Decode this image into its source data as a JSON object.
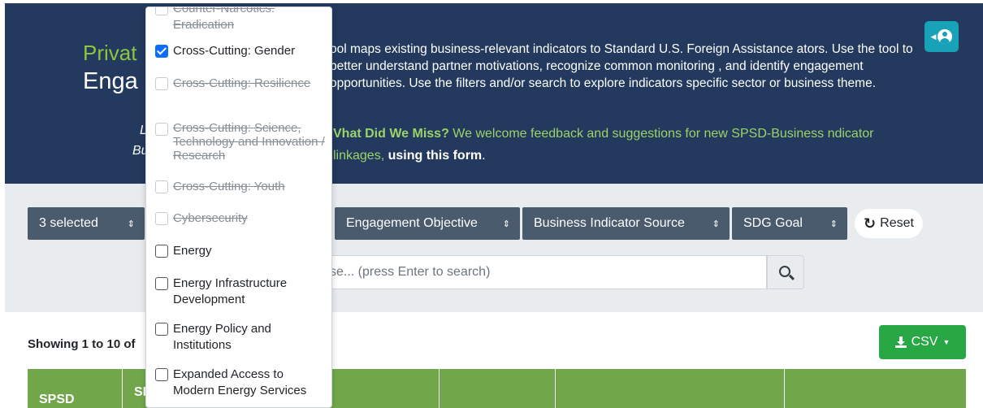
{
  "hero": {
    "title_line1": "Privat",
    "title_line2": "Enga",
    "description": "ool maps existing business-relevant indicators to Standard U.S. Foreign Assistance ators. Use the tool to better understand partner motivations, recognize common monitoring , and identify engagement opportunities. Use the filters and/or search to explore indicators specific sector or business theme.",
    "left_fragment1": "L",
    "left_fragment2": "Bu",
    "feedback_heading": "Vhat Did We Miss?",
    "feedback_text": " We welcome feedback and suggestions for new SPSD-Business ndicator linkages, ",
    "feedback_link": "using this form",
    "feedback_end": "."
  },
  "filters": {
    "sector_label": "3 selected",
    "engagement_objective": "Engagement Objective",
    "business_indicator_source": "Business Indicator Source",
    "sdg_goal": "SDG Goal",
    "sort_arrow": "⇕",
    "reset_icon": "↻",
    "reset_label": "Reset"
  },
  "search": {
    "placeholder": "se... (press Enter to search)"
  },
  "results": {
    "showing": "Showing 1 to 10 of",
    "csv_label": "CSV"
  },
  "table": {
    "col1": "SPSD",
    "col2": "SI"
  },
  "dropdown": {
    "options": [
      {
        "label": "Counter-Narcotics: Eradication",
        "state": "disabled"
      },
      {
        "label": "Cross-Cutting: Gender",
        "state": "checked"
      },
      {
        "label": "Cross-Cutting: Resilience",
        "state": "disabled"
      },
      {
        "label": "Cross-Cutting: Science, Technology and Innovation / Research",
        "state": "disabled"
      },
      {
        "label": "Cross-Cutting: Youth",
        "state": "disabled"
      },
      {
        "label": "Cybersecurity",
        "state": "disabled"
      },
      {
        "label": "Energy",
        "state": "unchecked"
      },
      {
        "label": "Energy Infrastructure Development",
        "state": "unchecked"
      },
      {
        "label": "Energy Policy and Institutions",
        "state": "unchecked"
      },
      {
        "label": "Expanded Access to Modern Energy Services",
        "state": "unchecked"
      }
    ]
  },
  "colors": {
    "hero_bg": "#23395d",
    "accent_green": "#8cc63f",
    "filter_button": "#4a5b6d",
    "table_header": "#71a74a",
    "csv_button": "#28a745",
    "profile_button": "#17a2b8"
  }
}
